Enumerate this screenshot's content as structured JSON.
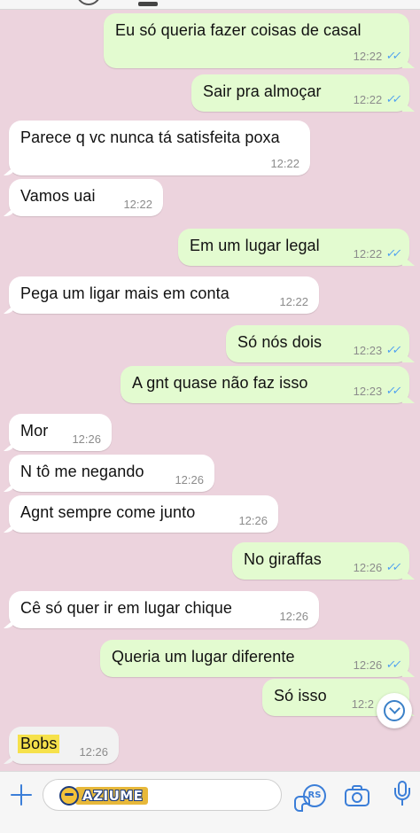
{
  "messages": [
    {
      "direction": "out",
      "text": "Eu só queria fazer coisas de casal",
      "time": "12:22",
      "read": true
    },
    {
      "direction": "out",
      "text": "Sair pra almoçar",
      "time": "12:22",
      "read": true
    },
    {
      "direction": "in",
      "text": "Parece q vc nunca tá satisfeita poxa",
      "time": "12:22"
    },
    {
      "direction": "in",
      "text": "Vamos uai",
      "time": "12:22"
    },
    {
      "direction": "out",
      "text": "Em um lugar legal",
      "time": "12:22",
      "read": true
    },
    {
      "direction": "in",
      "text": "Pega um ligar mais em conta",
      "time": "12:22"
    },
    {
      "direction": "out",
      "text": "Só nós dois",
      "time": "12:23",
      "read": true
    },
    {
      "direction": "out",
      "text": "A gnt quase não faz isso",
      "time": "12:23",
      "read": true
    },
    {
      "direction": "in",
      "text": "Mor",
      "time": "12:26"
    },
    {
      "direction": "in",
      "text": "N tô me negando",
      "time": "12:26"
    },
    {
      "direction": "in",
      "text": "Agnt sempre come junto",
      "time": "12:26"
    },
    {
      "direction": "out",
      "text": "No giraffas",
      "time": "12:26",
      "read": true
    },
    {
      "direction": "in",
      "text": "Cê só quer ir em lugar chique",
      "time": "12:26"
    },
    {
      "direction": "out",
      "text": "Queria um lugar diferente",
      "time": "12:26",
      "read": true
    },
    {
      "direction": "out",
      "text": "Só isso",
      "time": "12:2",
      "read": false
    },
    {
      "direction": "in",
      "text": "Bobs",
      "time": "12:26",
      "highlighted": true
    }
  ],
  "read_receipt": "✓✓",
  "input_bar": {
    "watermark_text": "AZIUME",
    "rs_label": "RS",
    "icons": [
      "plus-icon",
      "sticker-icon",
      "rs-icon",
      "camera-icon",
      "microphone-icon"
    ]
  },
  "colors": {
    "background": "#ecd3dd",
    "outgoing_bubble": "#e3fbd0",
    "incoming_bubble": "#ffffff",
    "read_ticks": "#4fa0f0",
    "icon_blue": "#3b7ed8",
    "highlight": "#f6e14b"
  }
}
